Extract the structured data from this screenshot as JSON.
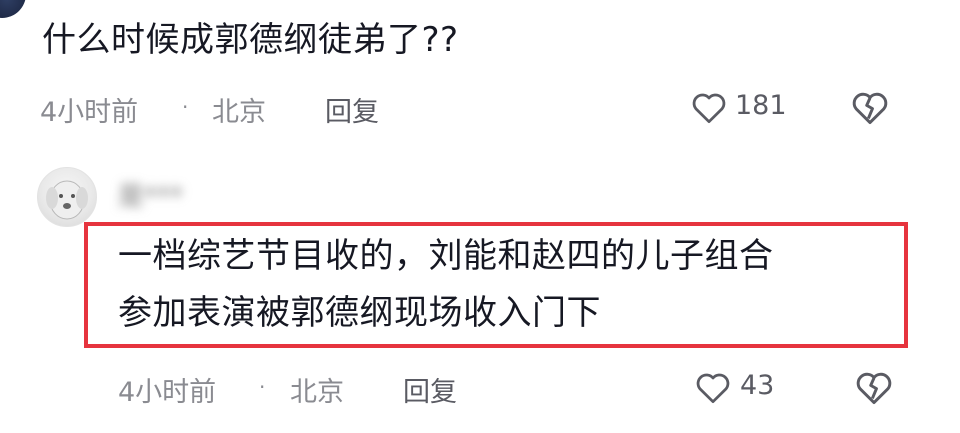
{
  "comment": {
    "text": "什么时候成郭德纲徒弟了??",
    "time": "4小时前",
    "separator": "·",
    "location": "北京",
    "reply_label": "回复",
    "likes": "181",
    "heart_icon": "heart-outline-icon",
    "dislike_icon": "broken-heart-icon"
  },
  "reply": {
    "username": "是***",
    "text_line1": "一档综艺节目收的，刘能和赵四的儿子组合",
    "text_line2": "参加表演被郭德纲现场收入门下",
    "time": "4小时前",
    "separator": "·",
    "location": "北京",
    "reply_label": "回复",
    "likes": "43",
    "highlight_color": "#e6343e"
  }
}
